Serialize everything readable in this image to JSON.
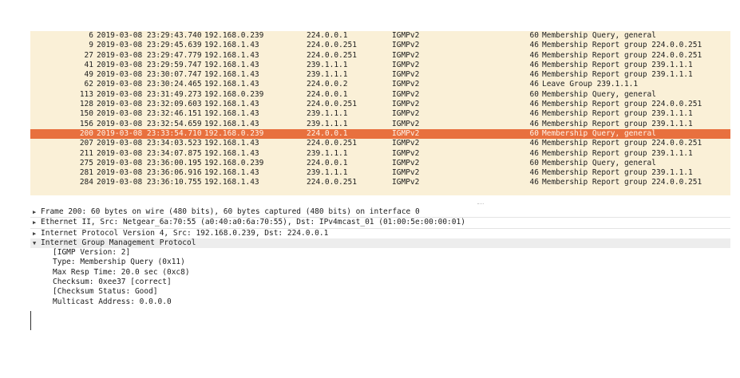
{
  "packets": [
    {
      "no": "6",
      "time": "2019-03-08 23:29:43.740",
      "src": "192.168.0.239",
      "dst": "224.0.0.1",
      "proto": "IGMPv2",
      "len": "60",
      "info": "Membership Query, general",
      "selected": false
    },
    {
      "no": "9",
      "time": "2019-03-08 23:29:45.639",
      "src": "192.168.1.43",
      "dst": "224.0.0.251",
      "proto": "IGMPv2",
      "len": "46",
      "info": "Membership Report group 224.0.0.251",
      "selected": false
    },
    {
      "no": "27",
      "time": "2019-03-08 23:29:47.779",
      "src": "192.168.1.43",
      "dst": "224.0.0.251",
      "proto": "IGMPv2",
      "len": "46",
      "info": "Membership Report group 224.0.0.251",
      "selected": false
    },
    {
      "no": "41",
      "time": "2019-03-08 23:29:59.747",
      "src": "192.168.1.43",
      "dst": "239.1.1.1",
      "proto": "IGMPv2",
      "len": "46",
      "info": "Membership Report group 239.1.1.1",
      "selected": false
    },
    {
      "no": "49",
      "time": "2019-03-08 23:30:07.747",
      "src": "192.168.1.43",
      "dst": "239.1.1.1",
      "proto": "IGMPv2",
      "len": "46",
      "info": "Membership Report group 239.1.1.1",
      "selected": false
    },
    {
      "no": "62",
      "time": "2019-03-08 23:30:24.465",
      "src": "192.168.1.43",
      "dst": "224.0.0.2",
      "proto": "IGMPv2",
      "len": "46",
      "info": "Leave Group 239.1.1.1",
      "selected": false
    },
    {
      "no": "113",
      "time": "2019-03-08 23:31:49.273",
      "src": "192.168.0.239",
      "dst": "224.0.0.1",
      "proto": "IGMPv2",
      "len": "60",
      "info": "Membership Query, general",
      "selected": false
    },
    {
      "no": "128",
      "time": "2019-03-08 23:32:09.603",
      "src": "192.168.1.43",
      "dst": "224.0.0.251",
      "proto": "IGMPv2",
      "len": "46",
      "info": "Membership Report group 224.0.0.251",
      "selected": false
    },
    {
      "no": "150",
      "time": "2019-03-08 23:32:46.151",
      "src": "192.168.1.43",
      "dst": "239.1.1.1",
      "proto": "IGMPv2",
      "len": "46",
      "info": "Membership Report group 239.1.1.1",
      "selected": false
    },
    {
      "no": "156",
      "time": "2019-03-08 23:32:54.659",
      "src": "192.168.1.43",
      "dst": "239.1.1.1",
      "proto": "IGMPv2",
      "len": "46",
      "info": "Membership Report group 239.1.1.1",
      "selected": false
    },
    {
      "no": "200",
      "time": "2019-03-08 23:33:54.710",
      "src": "192.168.0.239",
      "dst": "224.0.0.1",
      "proto": "IGMPv2",
      "len": "60",
      "info": "Membership Query, general",
      "selected": true
    },
    {
      "no": "207",
      "time": "2019-03-08 23:34:03.523",
      "src": "192.168.1.43",
      "dst": "224.0.0.251",
      "proto": "IGMPv2",
      "len": "46",
      "info": "Membership Report group 224.0.0.251",
      "selected": false
    },
    {
      "no": "211",
      "time": "2019-03-08 23:34:07.875",
      "src": "192.168.1.43",
      "dst": "239.1.1.1",
      "proto": "IGMPv2",
      "len": "46",
      "info": "Membership Report group 239.1.1.1",
      "selected": false
    },
    {
      "no": "275",
      "time": "2019-03-08 23:36:00.195",
      "src": "192.168.0.239",
      "dst": "224.0.0.1",
      "proto": "IGMPv2",
      "len": "60",
      "info": "Membership Query, general",
      "selected": false
    },
    {
      "no": "281",
      "time": "2019-03-08 23:36:06.916",
      "src": "192.168.1.43",
      "dst": "239.1.1.1",
      "proto": "IGMPv2",
      "len": "46",
      "info": "Membership Report group 239.1.1.1",
      "selected": false
    },
    {
      "no": "284",
      "time": "2019-03-08 23:36:10.755",
      "src": "192.168.1.43",
      "dst": "224.0.0.251",
      "proto": "IGMPv2",
      "len": "46",
      "info": "Membership Report group 224.0.0.251",
      "selected": false
    }
  ],
  "details": {
    "frame": "Frame 200: 60 bytes on wire (480 bits), 60 bytes captured (480 bits) on interface 0",
    "ethernet": "Ethernet II, Src: Netgear_6a:70:55 (a0:40:a0:6a:70:55), Dst: IPv4mcast_01 (01:00:5e:00:00:01)",
    "ip": "Internet Protocol Version 4, Src: 192.168.0.239, Dst: 224.0.0.1",
    "igmp": "Internet Group Management Protocol",
    "igmp_fields": [
      "[IGMP Version: 2]",
      "Type: Membership Query (0x11)",
      "Max Resp Time: 20.0 sec (0xc8)",
      "Checksum: 0xee37 [correct]",
      "[Checksum Status: Good]",
      "Multicast Address: 0.0.0.0"
    ],
    "arrow_collapsed": "▶",
    "arrow_expanded": "▼"
  },
  "colors": {
    "row_bg": "#faf0d7",
    "selected_bg": "#e8703e",
    "selected_fg": "#fff4ea"
  }
}
